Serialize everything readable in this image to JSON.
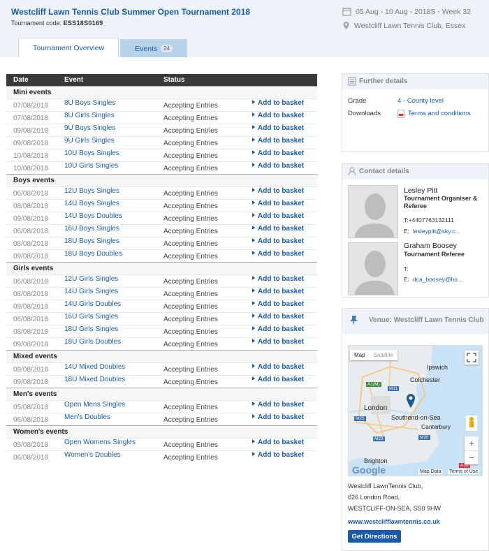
{
  "header": {
    "title": "Westcliff Lawn Tennis Club Summer Open Tournament 2018",
    "code_label": "Tournament code:",
    "code_value": "ESS18S0169",
    "dates": "05 Aug - 10 Aug - 2018S - Week 32",
    "venue": "Westcliff Lawn Tennis Club, Essex"
  },
  "tabs": [
    {
      "label": "Tournament Overview"
    },
    {
      "label": "Events",
      "count": "24"
    }
  ],
  "table": {
    "headers": {
      "date": "Date",
      "event": "Event",
      "status": "Status"
    },
    "groups": [
      {
        "name": "Mini events",
        "rows": [
          [
            "07/08/2018",
            "8U Boys Singles"
          ],
          [
            "07/08/2018",
            "8U Girls Singles"
          ],
          [
            "09/08/2018",
            "9U Boys Singles"
          ],
          [
            "09/08/2018",
            "9U Girls Singles"
          ],
          [
            "10/08/2018",
            "10U Boys Singles"
          ],
          [
            "10/08/2018",
            "10U Girls Singles"
          ]
        ]
      },
      {
        "name": "Boys events",
        "rows": [
          [
            "06/08/2018",
            "12U Boys Singles"
          ],
          [
            "08/08/2018",
            "14U Boys Singles"
          ],
          [
            "09/08/2018",
            "14U Boys Doubles"
          ],
          [
            "06/08/2018",
            "16U Boys Singles"
          ],
          [
            "08/08/2018",
            "18U Boys Singles"
          ],
          [
            "09/08/2018",
            "18U Boys Doubles"
          ]
        ]
      },
      {
        "name": "Girls events",
        "rows": [
          [
            "06/08/2018",
            "12U Girls Singles"
          ],
          [
            "08/08/2018",
            "14U Girls Singles"
          ],
          [
            "09/08/2018",
            "14U Girls Doubles"
          ],
          [
            "06/08/2018",
            "16U Girls Singles"
          ],
          [
            "08/08/2018",
            "18U Girls Singles"
          ],
          [
            "09/08/2018",
            "18U Girls Doubles"
          ]
        ]
      },
      {
        "name": "Mixed events",
        "rows": [
          [
            "09/08/2018",
            "14U Mixed Doubles"
          ],
          [
            "09/08/2018",
            "18U Mixed Doubles"
          ]
        ]
      },
      {
        "name": "Men's events",
        "rows": [
          [
            "05/08/2018",
            "Open Mens Singles"
          ],
          [
            "06/08/2018",
            "Men's Doubles"
          ]
        ]
      },
      {
        "name": "Women's events",
        "rows": [
          [
            "05/08/2018",
            "Open Womens Singles"
          ],
          [
            "06/08/2018",
            "Women's Doubles"
          ]
        ]
      }
    ],
    "status_text": "Accepting Entries",
    "action_label": "Add to basket"
  },
  "further": {
    "title": "Further details",
    "grade_label": "Grade",
    "grade_value": "4 - County level",
    "downloads_label": "Downloads",
    "downloads_value": "Terms and conditions"
  },
  "contacts": {
    "title": "Contact details",
    "people": [
      {
        "name": "Lesley Pitt",
        "role": "Tournament Organiser & Referee",
        "phone": "T:+4407763132111",
        "email_label": "E:",
        "email": "lesleypitt@sky.c..."
      },
      {
        "name": "Graham Boosey",
        "role": "Tournament Referee",
        "phone": "T:",
        "email_label": "E:",
        "email": "dca_boosey@ho..."
      }
    ]
  },
  "venue": {
    "title": "Venue: Westcliff Lawn Tennis Club",
    "map": {
      "map_btn": "Map",
      "satellite_btn": "Satellite",
      "places": [
        "Ipswich",
        "Colchester",
        "London",
        "Southend-on-Sea",
        "Canterbury",
        "Brighton"
      ],
      "roads": [
        "A1(M)",
        "M11",
        "M25",
        "M23",
        "M20",
        "A16"
      ],
      "brand": "Google",
      "map_data": "Map Data",
      "terms": "Terms of Use",
      "zoom_in": "+",
      "zoom_out": "−"
    },
    "address": [
      "Westcliff LawnTennis Club,",
      "626 London Road,",
      "WESTCLIFF-ON-SEA, SS0 9HW"
    ],
    "website": "www.westclifflawntennis.co.uk",
    "directions": "Get Directions"
  },
  "colors": {
    "link": "#1a5aa6",
    "header_bg": "#eef3f9",
    "table_head": "#3a3a3a",
    "tab_inactive": "#b9d2ec"
  }
}
